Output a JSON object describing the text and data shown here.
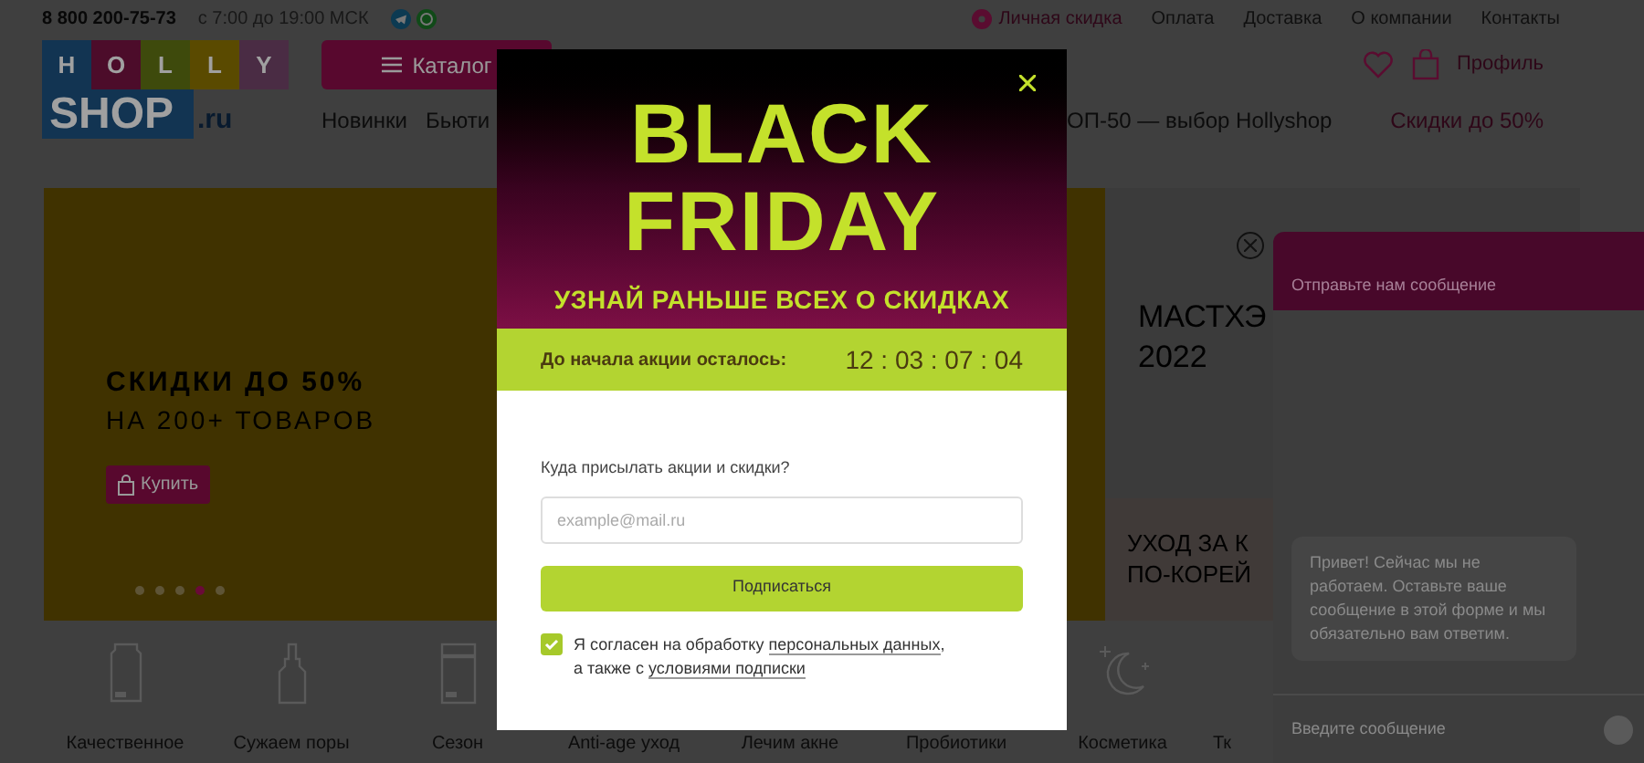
{
  "topbar": {
    "phone": "8 800 200-75-73",
    "hours": "с 7:00 до 19:00 МСК",
    "promo_link": "Личная скидка",
    "links": [
      "Оплата",
      "Доставка",
      "О компании",
      "Контакты"
    ]
  },
  "header": {
    "logo": {
      "letters": [
        {
          "char": "H",
          "color": "#123452"
        },
        {
          "char": "O",
          "color": "#4c0c2a"
        },
        {
          "char": "L",
          "color": "#3e4a0c"
        },
        {
          "char": "L",
          "color": "#5a4a00"
        },
        {
          "char": "Y",
          "color": "#4a2c44"
        }
      ],
      "word": "SHOP",
      "domain": ".ru"
    },
    "catalog_button": "Каталог",
    "profile": "Профиль"
  },
  "nav": {
    "items": [
      "Новинки",
      "Бьюти"
    ],
    "partial_item": "ОП-50 — выбор Hollyshop",
    "promo": "Скидки до 50%"
  },
  "banner": {
    "title": "СКИДКИ ДО 50%",
    "subtitle": "НА 200+ ТОВАРОВ",
    "button": "Купить",
    "dots": [
      {
        "selected": false
      },
      {
        "selected": false
      },
      {
        "selected": false
      },
      {
        "selected": true
      },
      {
        "selected": false
      }
    ]
  },
  "side_banner": {
    "title_lines": [
      "МАСТХЭ",
      "2022"
    ],
    "bottom_lines": [
      "УХОД ЗА К",
      "ПО-КОРЕЙ"
    ]
  },
  "categories": [
    "Качественное",
    "Сужаем поры",
    "Сезон",
    "Anti-age уход",
    "Лечим акне",
    "Пробиотики",
    "Косметика",
    "Тк"
  ],
  "modal": {
    "title_lines": [
      "BLACK",
      "FRIDAY"
    ],
    "tagline": "УЗНАЙ РАНЬШЕ ВСЕХ О СКИДКАХ",
    "countdown_label": "До начала акции осталось:",
    "countdown": "12 : 03 : 07 : 04",
    "field_label": "Куда присылать акции и скидки?",
    "email_placeholder": "example@mail.ru",
    "submit": "Подписаться",
    "consent": {
      "checked": true,
      "line_1": "Я согласен на обработку ",
      "link_1": "персональных данных",
      "line_1_end": ",",
      "line_2": "а также с ",
      "link_2": "условиями подписки"
    }
  },
  "chat": {
    "title": "Отправьте нам сообщение",
    "message": "Привет! Сейчас мы не работаем. Оставьте ваше сообщение в этой форме и мы обязательно вам ответим.",
    "input_placeholder": "Введите сообщение"
  }
}
